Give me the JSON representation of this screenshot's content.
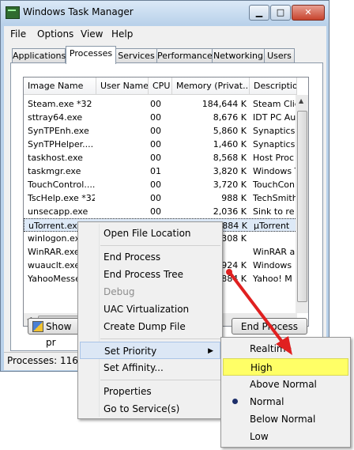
{
  "window": {
    "title": "Windows Task Manager",
    "min": "▁",
    "max": "□",
    "close": "✕"
  },
  "menubar": [
    "File",
    "Options",
    "View",
    "Help"
  ],
  "tabs": [
    "Applications",
    "Processes",
    "Services",
    "Performance",
    "Networking",
    "Users"
  ],
  "active_tab": "Processes",
  "columns": [
    "Image Name",
    "User Name",
    "CPU",
    "Memory (Privat...",
    "Descriptio"
  ],
  "rows": [
    {
      "name": "Steam.exe *32",
      "user": "",
      "cpu": "00",
      "mem": "184,644 K",
      "desc": "Steam Clie"
    },
    {
      "name": "sttray64.exe",
      "user": "",
      "cpu": "00",
      "mem": "8,676 K",
      "desc": "IDT PC Au"
    },
    {
      "name": "SynTPEnh.exe",
      "user": "",
      "cpu": "00",
      "mem": "5,860 K",
      "desc": "Synaptics"
    },
    {
      "name": "SynTPHelper....",
      "user": "",
      "cpu": "00",
      "mem": "1,460 K",
      "desc": "Synaptics"
    },
    {
      "name": "taskhost.exe",
      "user": "",
      "cpu": "00",
      "mem": "8,568 K",
      "desc": "Host Proc"
    },
    {
      "name": "taskmgr.exe",
      "user": "",
      "cpu": "01",
      "mem": "3,820 K",
      "desc": "Windows T"
    },
    {
      "name": "TouchControl....",
      "user": "",
      "cpu": "00",
      "mem": "3,720 K",
      "desc": "TouchCon"
    },
    {
      "name": "TscHelp.exe *32",
      "user": "",
      "cpu": "00",
      "mem": "988 K",
      "desc": "TechSmith"
    },
    {
      "name": "unsecapp.exe",
      "user": "",
      "cpu": "00",
      "mem": "2,036 K",
      "desc": "Sink to re"
    },
    {
      "name": "uTorrent.exe",
      "user": "",
      "cpu": "",
      "mem": "884 K",
      "desc": "µTorrent"
    },
    {
      "name": "winlogon.exe",
      "user": "",
      "cpu": "",
      "mem": "308 K",
      "desc": ""
    },
    {
      "name": "WinRAR.exe",
      "user": "",
      "cpu": "",
      "mem": "",
      "desc": "WinRAR a"
    },
    {
      "name": "wuauclt.exe",
      "user": "",
      "cpu": "",
      "mem": "924 K",
      "desc": "Windows"
    },
    {
      "name": "YahooMesse",
      "user": "",
      "cpu": "",
      "mem": "884 K",
      "desc": "Yahoo! M"
    }
  ],
  "buttons": {
    "show_processes": "Show pr",
    "end_process": "End Process"
  },
  "status": {
    "processes": "Processes: 116"
  },
  "context_menu": {
    "open_file_location": "Open File Location",
    "end_process": "End Process",
    "end_process_tree": "End Process Tree",
    "debug": "Debug",
    "uac_virtualization": "UAC Virtualization",
    "create_dump_file": "Create Dump File",
    "set_priority": "Set Priority",
    "set_affinity": "Set Affinity...",
    "properties": "Properties",
    "go_to_services": "Go to Service(s)"
  },
  "priority_menu": {
    "realtime": "Realtime",
    "high": "High",
    "above_normal": "Above Normal",
    "normal": "Normal",
    "below_normal": "Below Normal",
    "low": "Low",
    "selected": "Normal"
  },
  "colors": {
    "annotation_arrow": "#e02020",
    "highlight": "#ffff66"
  }
}
